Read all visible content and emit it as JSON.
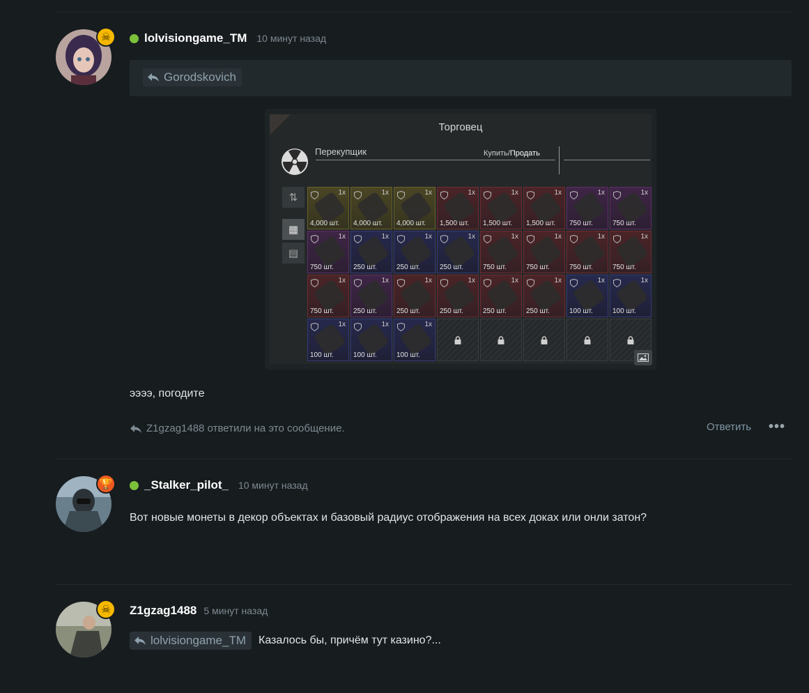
{
  "post1": {
    "username": "lolvisiongame_TM",
    "time": "10 минут назад",
    "quote_author": "Gorodskovich",
    "text": "ээээ, погодите",
    "replies_note": "Z1gzag1488 ответили на это сообщение.",
    "reply_label": "Ответить",
    "more_label": "•••",
    "badge_icon": "skull-icon",
    "online": true
  },
  "game_screenshot": {
    "title": "Торговец",
    "trader_name": "Перекупщик",
    "buy_label": "Купить",
    "separator": "/",
    "sell_label": "Продать",
    "cells": [
      {
        "color": "yellow",
        "qty": "1x",
        "price": "4,000 шт."
      },
      {
        "color": "yellow",
        "qty": "1x",
        "price": "4,000 шт."
      },
      {
        "color": "yellow",
        "qty": "1x",
        "price": "4,000 шт."
      },
      {
        "color": "red",
        "qty": "1x",
        "price": "1,500 шт."
      },
      {
        "color": "red",
        "qty": "1x",
        "price": "1,500 шт."
      },
      {
        "color": "red",
        "qty": "1x",
        "price": "1,500 шт."
      },
      {
        "color": "purple",
        "qty": "1x",
        "price": "750 шт."
      },
      {
        "color": "purple",
        "qty": "1x",
        "price": "750 шт."
      },
      {
        "color": "purple",
        "qty": "1x",
        "price": "750 шт."
      },
      {
        "color": "blue",
        "qty": "1x",
        "price": "250 шт."
      },
      {
        "color": "blue",
        "qty": "1x",
        "price": "250 шт."
      },
      {
        "color": "blue",
        "qty": "1x",
        "price": "250 шт."
      },
      {
        "color": "red",
        "qty": "1x",
        "price": "750 шт."
      },
      {
        "color": "red",
        "qty": "1x",
        "price": "750 шт."
      },
      {
        "color": "red",
        "qty": "1x",
        "price": "750 шт."
      },
      {
        "color": "red",
        "qty": "1x",
        "price": "750 шт."
      },
      {
        "color": "red",
        "qty": "1x",
        "price": "750 шт."
      },
      {
        "color": "purple",
        "qty": "1x",
        "price": "250 шт."
      },
      {
        "color": "red",
        "qty": "1x",
        "price": "250 шт."
      },
      {
        "color": "red",
        "qty": "1x",
        "price": "250 шт."
      },
      {
        "color": "red",
        "qty": "1x",
        "price": "250 шт."
      },
      {
        "color": "red",
        "qty": "1x",
        "price": "250 шт."
      },
      {
        "color": "blue",
        "qty": "1x",
        "price": "100 шт."
      },
      {
        "color": "blue",
        "qty": "1x",
        "price": "100 шт."
      },
      {
        "color": "blue",
        "qty": "1x",
        "price": "100 шт."
      },
      {
        "color": "blue",
        "qty": "1x",
        "price": "100 шт."
      },
      {
        "color": "blue",
        "qty": "1x",
        "price": "100 шт."
      },
      {
        "color": "locked",
        "qty": "",
        "price": ""
      },
      {
        "color": "locked",
        "qty": "",
        "price": ""
      },
      {
        "color": "locked",
        "qty": "",
        "price": ""
      },
      {
        "color": "locked",
        "qty": "",
        "price": ""
      },
      {
        "color": "locked",
        "qty": "",
        "price": ""
      }
    ]
  },
  "post2": {
    "username": "_Stalker_pilot_",
    "time": "10 минут назад",
    "text": "Вот новые монеты в декор объектах и базовый радиус отображения на всех доках или онли затон?",
    "badge_icon": "trophy-icon",
    "online": true
  },
  "post3": {
    "username": "Z1gzag1488",
    "time": "5 минут назад",
    "quote_author": "lolvisiongame_TM",
    "text": "Казалось бы, причём тут казино?...",
    "badge_icon": "skull-icon"
  },
  "colors": {
    "background": "#171c1f",
    "online": "#7cc13a",
    "badge_gold": "#f5b800",
    "badge_orange": "#ef5a1f",
    "link": "#7f96a5"
  }
}
